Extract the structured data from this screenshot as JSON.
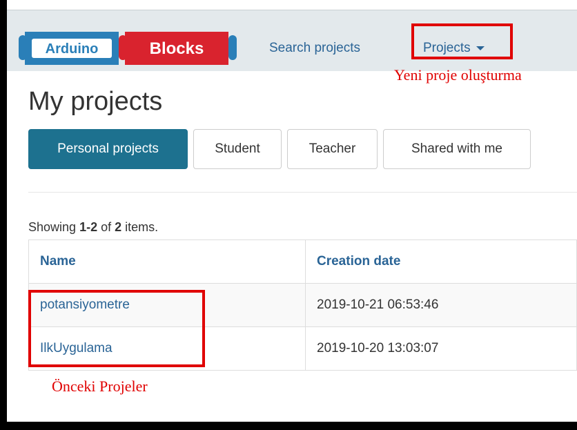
{
  "logo": {
    "part1": "Arduino",
    "part2": "Blocks",
    "blue": "#2a7fb8",
    "red": "#d9232e"
  },
  "nav": {
    "search_label": "Search projects",
    "projects_label": "Projects"
  },
  "annotations": {
    "new_project": "Yeni proje oluşturma",
    "previous_projects": "Önceki Projeler",
    "highlight_color": "#e00000"
  },
  "page": {
    "title": "My projects"
  },
  "tabs": [
    {
      "label": "Personal projects",
      "active": true
    },
    {
      "label": "Student",
      "active": false
    },
    {
      "label": "Teacher",
      "active": false
    },
    {
      "label": "Shared with me",
      "active": false
    }
  ],
  "summary": {
    "prefix": "Showing ",
    "range": "1-2",
    "middle": " of ",
    "total": "2",
    "suffix": " items."
  },
  "table": {
    "columns": [
      "Name",
      "Creation date"
    ],
    "rows": [
      {
        "name": "potansiyometre",
        "created": "2019-10-21 06:53:46"
      },
      {
        "name": "IlkUygulama",
        "created": "2019-10-20 13:03:07"
      }
    ]
  },
  "colors": {
    "accent": "#1d718f",
    "link": "#2a6496",
    "navbar_bg": "#e3e9ec"
  }
}
